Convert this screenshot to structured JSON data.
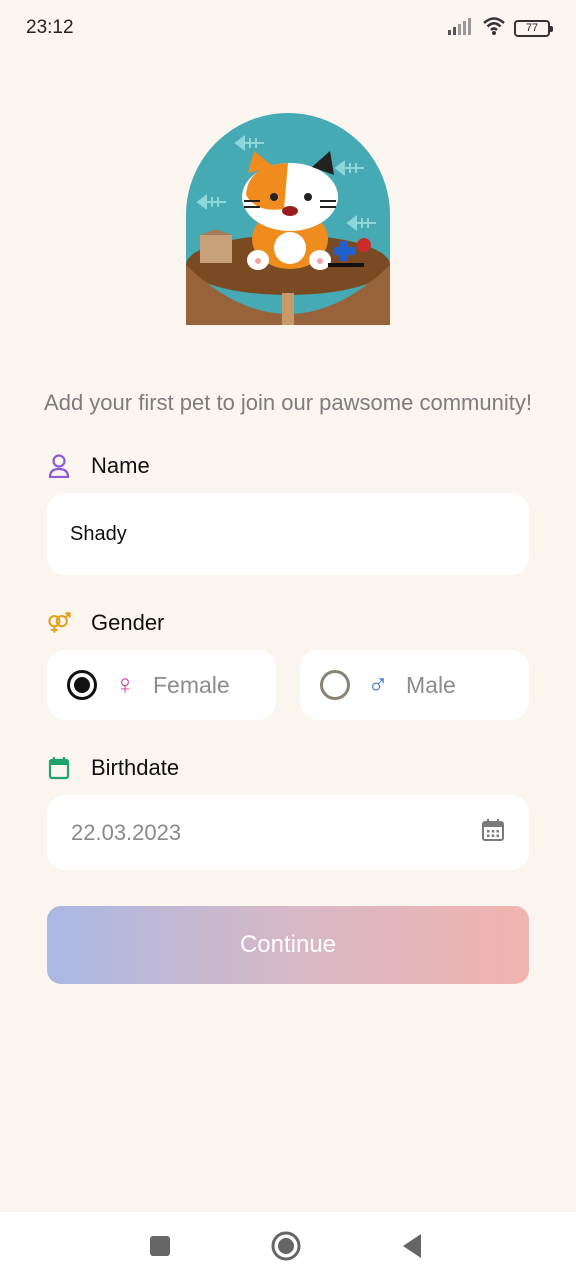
{
  "status_bar": {
    "time": "23:12",
    "battery": "77"
  },
  "hero": {
    "illustration": "cat-at-table-illustration"
  },
  "subtitle": "Add your first pet to join our pawsome community!",
  "name_section": {
    "label": "Name",
    "icon": "person-icon",
    "value": "Shady"
  },
  "gender_section": {
    "label": "Gender",
    "icon": "gender-icon",
    "options": [
      {
        "label": "Female",
        "symbol": "♀",
        "selected": true,
        "color": "#d63f9c"
      },
      {
        "label": "Male",
        "symbol": "♂",
        "selected": false,
        "color": "#2f73d6"
      }
    ]
  },
  "birthdate_section": {
    "label": "Birthdate",
    "icon": "calendar-icon",
    "value": "22.03.2023"
  },
  "continue_button": {
    "label": "Continue"
  },
  "colors": {
    "background": "#faf5ef",
    "name_icon": "#8e5bd3",
    "gender_icon": "#e0a21c",
    "birthdate_icon": "#1ea36b",
    "button_gradient_start": "#aab8e4",
    "button_gradient_end": "#f2b4b0"
  }
}
